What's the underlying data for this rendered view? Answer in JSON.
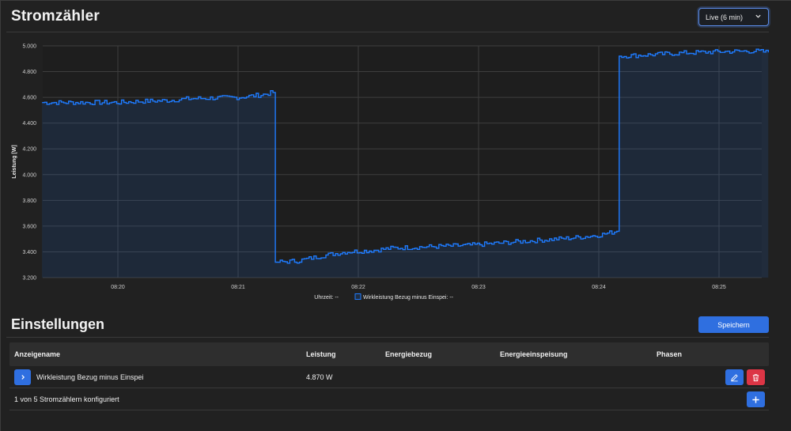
{
  "header": {
    "title": "Stromzähler",
    "range_select": "Live (6 min)"
  },
  "settings": {
    "title": "Einstellungen",
    "save_label": "Speichern"
  },
  "table": {
    "columns": [
      "Anzeigename",
      "Leistung",
      "Energiebezug",
      "Energieeinspeisung",
      "Phasen"
    ],
    "rows": [
      {
        "name": "Wirkleistung Bezug minus Einspei",
        "power": "4.870 W",
        "energy_in": "",
        "energy_out": "",
        "phases": ""
      }
    ],
    "footer": "1 von 5 Stromzählern konfiguriert"
  },
  "colors": {
    "accent": "#2f6fe0",
    "danger": "#dc3545",
    "line": "#1e7bff",
    "background": "#212121"
  },
  "chart_data": {
    "type": "line",
    "ylabel": "Leistung [W]",
    "ylim": [
      3200,
      5000
    ],
    "yticks": [
      "3.200",
      "3.400",
      "3.600",
      "3.800",
      "4.000",
      "4.200",
      "4.400",
      "4.600",
      "4.800",
      "5.000"
    ],
    "xticks": [
      "08:20",
      "08:21",
      "08:22",
      "08:23",
      "08:24",
      "08:25"
    ],
    "legend": {
      "x_label": "Uhrzeit:",
      "x_value": "--",
      "series_label": "Wirkleistung Bezug minus Einspei:",
      "series_value": "--"
    },
    "grid": true,
    "series": [
      {
        "name": "Wirkleistung Bezug minus Einspei",
        "x_minutes": [
          0,
          0.2,
          0.4,
          0.6,
          0.8,
          1.0,
          1.2,
          1.3,
          1.32,
          1.5,
          1.7,
          1.9,
          2.1,
          2.3,
          2.6,
          2.9,
          3.2,
          3.5,
          3.8,
          4.0,
          4.15,
          4.17,
          4.4,
          4.7,
          5.0,
          5.3,
          5.42
        ],
        "y": [
          4560,
          4570,
          4575,
          4590,
          4595,
          4600,
          4620,
          4640,
          3320,
          3330,
          3370,
          3400,
          3410,
          3430,
          3440,
          3450,
          3470,
          3490,
          3510,
          3530,
          3560,
          4920,
          4930,
          4945,
          4955,
          4960,
          4950
        ]
      }
    ]
  }
}
